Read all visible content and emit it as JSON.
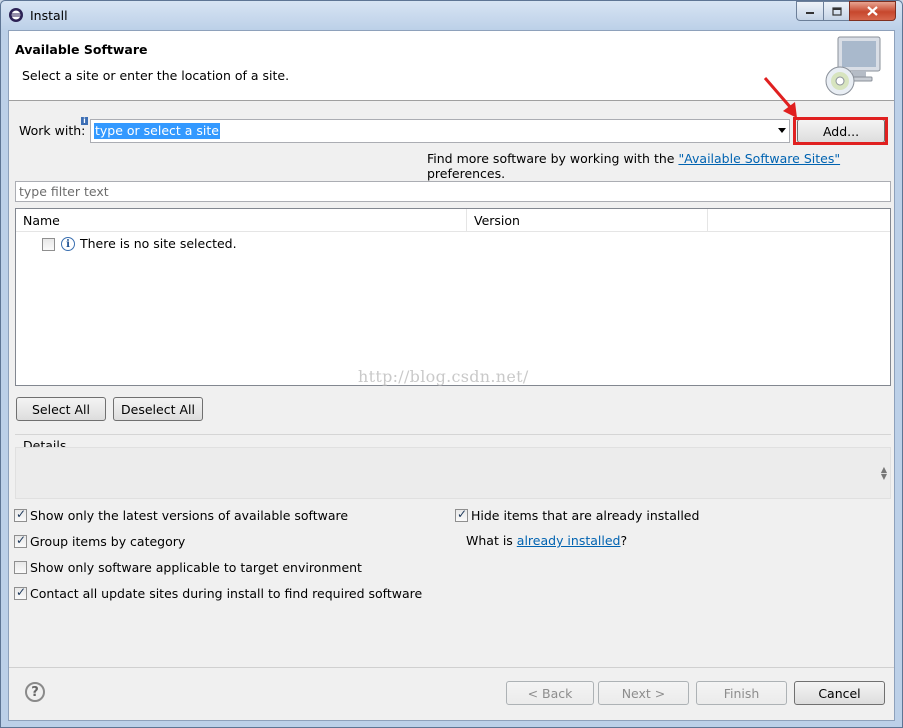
{
  "window": {
    "title": "Install"
  },
  "header": {
    "title": "Available Software",
    "description": "Select a site or enter the location of a site."
  },
  "work_with": {
    "label": "Work with:",
    "value": "type or select a site",
    "add_button": "Add..."
  },
  "find_more": {
    "prefix": "Find more software by working with the ",
    "link": "\"Available Software Sites\"",
    "suffix": " preferences."
  },
  "filter": {
    "placeholder": "type filter text"
  },
  "table": {
    "columns": [
      "Name",
      "Version"
    ],
    "rows": [
      {
        "text": "There is no site selected.",
        "checked": false
      }
    ]
  },
  "watermark": "http://blog.csdn.net/",
  "select_all": "Select All",
  "deselect_all": "Deselect All",
  "details": {
    "label": "Details"
  },
  "options_left": [
    {
      "label": "Show only the latest versions of available software",
      "checked": true
    },
    {
      "label": "Group items by category",
      "checked": true
    },
    {
      "label": "Show only software applicable to target environment",
      "checked": false
    },
    {
      "label": "Contact all update sites during install to find required software",
      "checked": true
    }
  ],
  "options_right": {
    "hide_installed": {
      "label": "Hide items that are already installed",
      "checked": true
    },
    "what_is_prefix": "What is ",
    "what_is_link": "already installed",
    "what_is_suffix": "?"
  },
  "footer": {
    "back": "< Back",
    "next": "Next >",
    "finish": "Finish",
    "cancel": "Cancel"
  },
  "colors": {
    "highlight": "#e02020",
    "link": "#0063b1",
    "selection": "#3399ff"
  }
}
